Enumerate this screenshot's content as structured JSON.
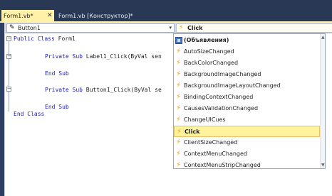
{
  "tabs": [
    {
      "label": "Form1.vb*",
      "close": "✕"
    },
    {
      "label": "Form1.vb [Конструктор]*"
    }
  ],
  "nav": {
    "object_combo": "Button1",
    "event_combo": "Click",
    "arrow": "▾"
  },
  "code_lines": [
    {
      "kw": "Public Class ",
      "rest": "Form1"
    },
    {
      "kw": "Private Sub ",
      "rest": "Label1_Click(ByVal sen"
    },
    {
      "kw": "End Sub",
      "rest": ""
    },
    {
      "kw": "Private Sub ",
      "rest": "Button1_Click(ByVal se"
    },
    {
      "kw": "End Sub",
      "rest": ""
    },
    {
      "kw": "End Class",
      "rest": ""
    }
  ],
  "dropdown": {
    "header": "(Объявления)",
    "items": [
      "AutoSizeChanged",
      "BackColorChanged",
      "BackgroundImageChanged",
      "BackgroundImageLayoutChanged",
      "BindingContextChanged",
      "CausesValidationChanged",
      "ChangeUICues",
      "Click",
      "ClientSizeChanged",
      "ContextMenuChanged",
      "ContextMenuStripChanged"
    ],
    "selected": "Click"
  },
  "icons": {
    "event": "lightning-bolt-icon",
    "object": "button-object-icon",
    "declarations": "declarations-icon"
  },
  "colors": {
    "active_tab": "#fff1a8",
    "selected_item": "#fff29d",
    "keyword": "#1a1ab8",
    "event_bolt": "#e3a21a"
  }
}
